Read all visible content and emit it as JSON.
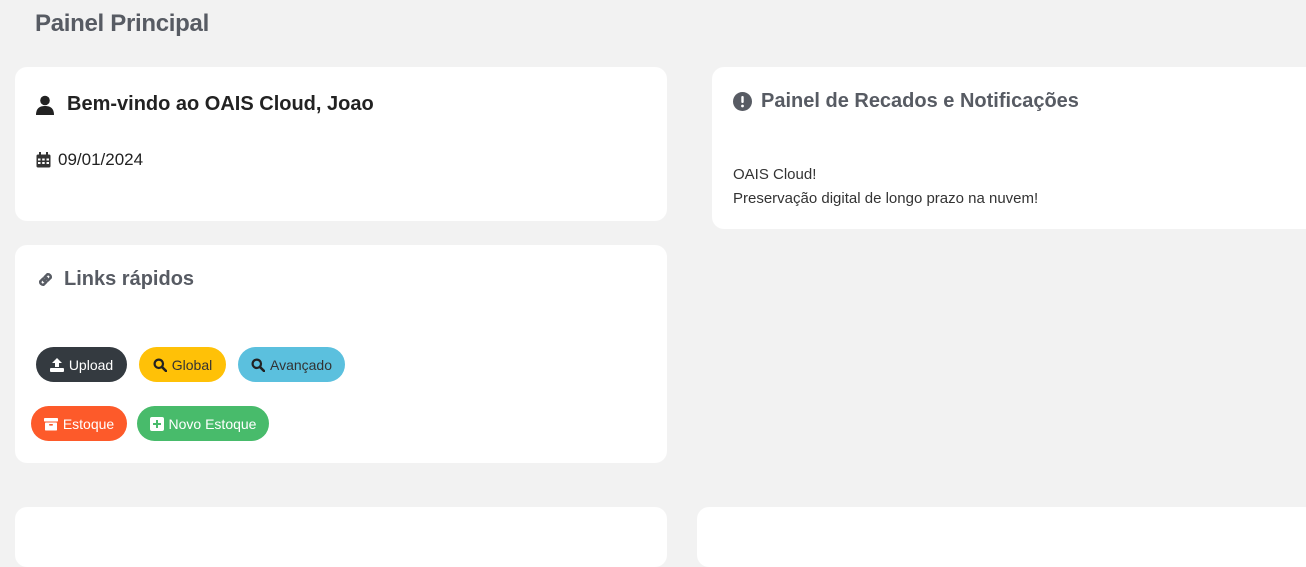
{
  "page": {
    "title": "Painel Principal"
  },
  "welcome": {
    "icon": "user-icon",
    "title": "Bem-vindo ao OAIS Cloud, Joao",
    "date_icon": "calendar-icon",
    "date": "09/01/2024"
  },
  "links": {
    "icon": "link-icon",
    "heading": "Links rápidos",
    "buttons": [
      {
        "label": "Upload",
        "icon": "upload-icon",
        "color": "#343a40"
      },
      {
        "label": "Global",
        "icon": "search-icon",
        "color": "#ffc107"
      },
      {
        "label": "Avançado",
        "icon": "search-icon",
        "color": "#5bc0de"
      },
      {
        "label": "Estoque",
        "icon": "archive-icon",
        "color": "#fd5a2a"
      },
      {
        "label": "Novo Estoque",
        "icon": "plus-square-icon",
        "color": "#48bb6b"
      }
    ]
  },
  "notifications": {
    "icon": "exclamation-circle-icon",
    "heading": "Painel de Recados e Notificações",
    "lines": [
      "OAIS Cloud!",
      "Preservação digital de longo prazo na nuvem!"
    ]
  }
}
